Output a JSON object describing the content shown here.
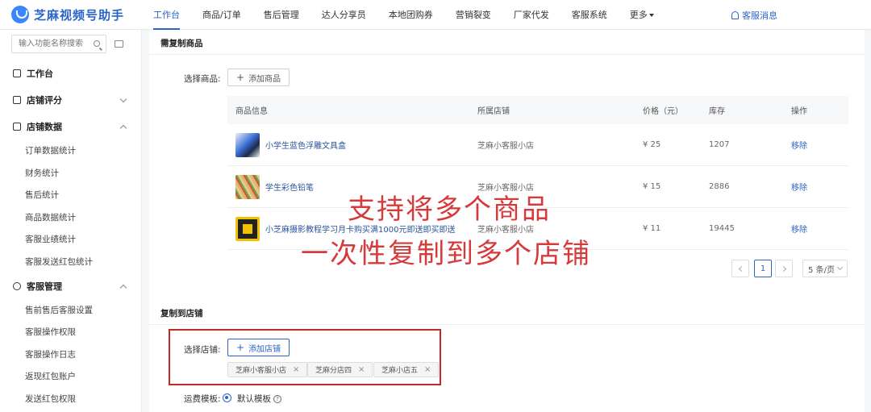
{
  "app": {
    "title": "芝麻视频号助手"
  },
  "nav": {
    "items": [
      "工作台",
      "商品/订单",
      "售后管理",
      "达人分享员",
      "本地团购券",
      "营销裂变",
      "厂家代发",
      "客服系统"
    ],
    "more": "更多",
    "message": "客服消息"
  },
  "sidebar": {
    "search_placeholder": "输入功能名称搜索",
    "workbench": "工作台",
    "store_rating": "店铺评分",
    "store_data": "店铺数据",
    "store_data_items": [
      "订单数据统计",
      "财务统计",
      "售后统计",
      "商品数据统计",
      "客服业绩统计",
      "客服发送红包统计"
    ],
    "service_mgmt": "客服管理",
    "service_items": [
      "售前售后客服设置",
      "客服操作权限",
      "客服操作日志",
      "返现红包账户",
      "发送红包权限"
    ]
  },
  "copy_goods": {
    "section_title": "需复制商品",
    "select_label": "选择商品:",
    "add_button": "添加商品",
    "columns": [
      "商品信息",
      "所属店铺",
      "价格（元）",
      "库存",
      "操作"
    ],
    "rows": [
      {
        "name": "小学生蓝色浮雕文具盒",
        "store": "芝麻小客服小店",
        "price": "¥ 25",
        "stock": "1207",
        "action": "移除"
      },
      {
        "name": "学生彩色铅笔",
        "store": "芝麻小客服小店",
        "price": "¥ 15",
        "stock": "2886",
        "action": "移除"
      },
      {
        "name": "小芝麻摄影教程学习月卡购买满1000元即送即买即送",
        "store": "芝麻小客服小店",
        "price": "¥ 11",
        "stock": "19445",
        "action": "移除"
      }
    ],
    "pagination": {
      "current": "1",
      "page_size": "5 条/页"
    }
  },
  "copy_to_store": {
    "section_title": "复制到店铺",
    "select_label": "选择店铺:",
    "add_button": "添加店铺",
    "tags": [
      "芝麻小客服小店",
      "芝麻分店四",
      "芝麻小店五"
    ],
    "shipping_label": "运费模板:",
    "shipping_default": "默认模板"
  },
  "annotation": {
    "line1": "支持将多个商品",
    "line2": "一次性复制到多个店铺",
    "color": "#d63a3a"
  },
  "colors": {
    "accent": "#2a64c8",
    "highlight_box": "#c62828"
  }
}
